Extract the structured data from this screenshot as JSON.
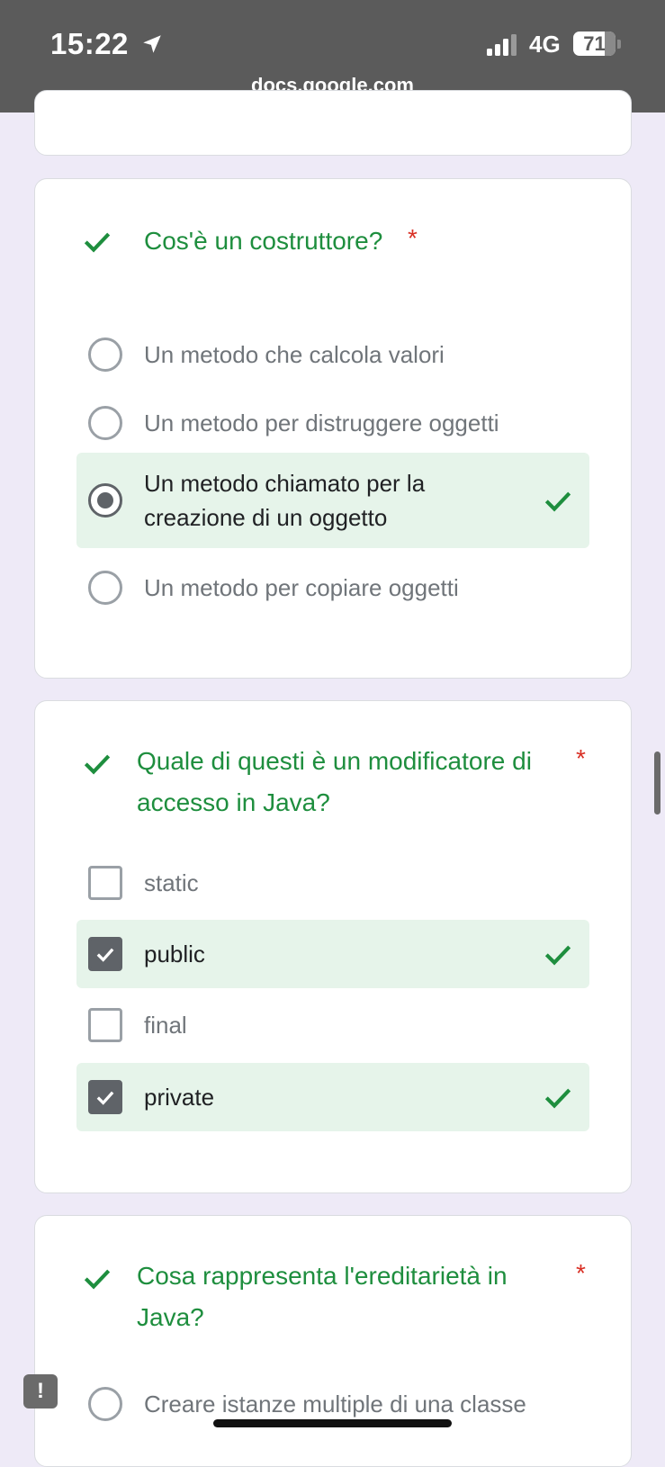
{
  "status_bar": {
    "time": "15:22",
    "network": "4G",
    "battery": "71",
    "url": "docs.google.com",
    "icons": [
      "location-arrow-icon",
      "signal-bars-icon",
      "battery-icon"
    ]
  },
  "colors": {
    "background": "#eeeaf7",
    "correct_green": "#1e8e3e",
    "correct_bg": "#e6f4ea",
    "required_red": "#d93025",
    "status_bar": "#5b5b5b"
  },
  "questions": [
    {
      "title": "Cos'è un costruttore?",
      "required_mark": "*",
      "type": "radio",
      "options": [
        {
          "label": "Un metodo che calcola valori",
          "selected": false,
          "correct": false
        },
        {
          "label": "Un metodo per distruggere oggetti",
          "selected": false,
          "correct": false
        },
        {
          "label": "Un metodo chiamato per la creazione di un oggetto",
          "selected": true,
          "correct": true
        },
        {
          "label": "Un metodo per copiare oggetti",
          "selected": false,
          "correct": false
        }
      ]
    },
    {
      "title": "Quale di questi è un modificatore di accesso in Java?",
      "required_mark": "*",
      "type": "checkbox",
      "options": [
        {
          "label": "static",
          "selected": false,
          "correct": false
        },
        {
          "label": "public",
          "selected": true,
          "correct": true
        },
        {
          "label": "final",
          "selected": false,
          "correct": false
        },
        {
          "label": "private",
          "selected": true,
          "correct": true
        }
      ]
    },
    {
      "title": "Cosa rappresenta l'ereditarietà in Java?",
      "required_mark": "*",
      "type": "radio",
      "options": [
        {
          "label": "Creare istanze multiple di una classe",
          "selected": false,
          "correct": false
        }
      ]
    }
  ],
  "feedback_button": "!"
}
